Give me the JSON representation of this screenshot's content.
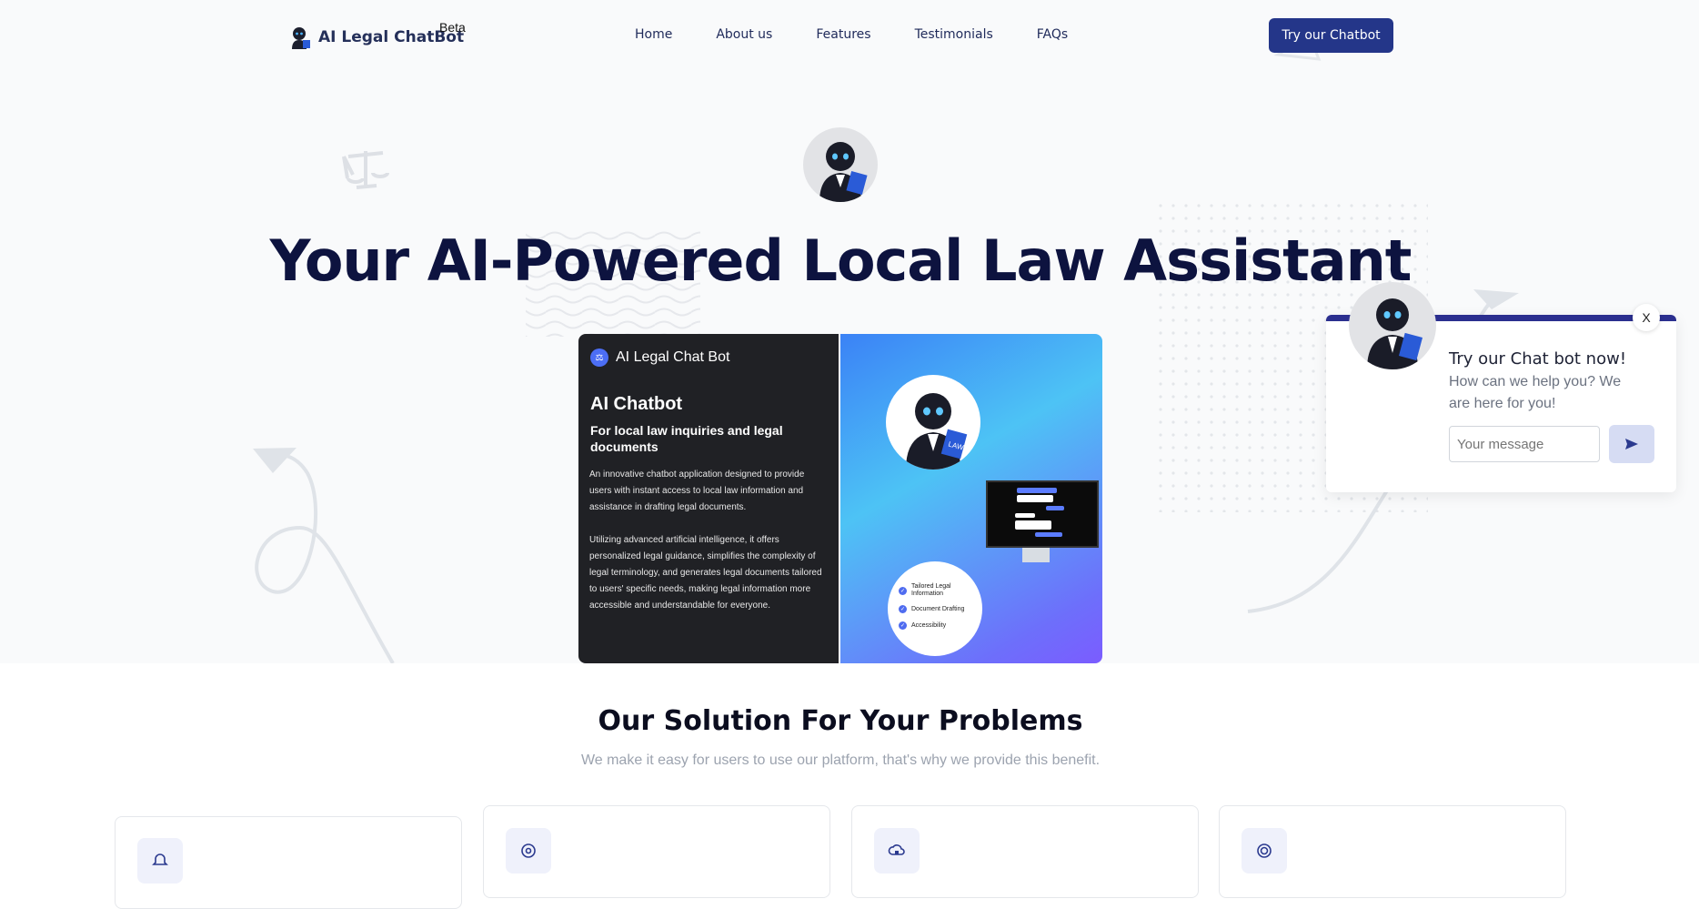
{
  "nav": {
    "logo_text": "AI Legal ChatBot",
    "beta": "Beta",
    "links": [
      "Home",
      "About us",
      "Features",
      "Testimonials",
      "FAQs"
    ],
    "cta": "Try our Chatbot"
  },
  "hero": {
    "headline": "Your AI-Powered Local Law Assistant"
  },
  "preview": {
    "app_title": "AI Legal Chat Bot",
    "heading": "AI Chatbot",
    "subheading": "For local law inquiries and legal documents",
    "para1": "An innovative chatbot application designed to provide users with instant access to local law information and assistance in drafting legal documents.",
    "para2": "Utilizing advanced artificial intelligence, it offers personalized legal guidance, simplifies the complexity of legal terminology, and generates legal documents tailored to users' specific needs, making legal information more accessible and understandable for everyone.",
    "book_label": "LAW",
    "features": [
      "Tailored Legal Information",
      "Document Drafting",
      "Accessibility"
    ]
  },
  "widget": {
    "close": "X",
    "title": "Try our Chat bot now!",
    "subtitle": "How can we help you? We are here for you!",
    "placeholder": "Your message"
  },
  "solution": {
    "title": "Our Solution For Your Problems",
    "subtitle": "We make it easy for users to use our platform, that's why we provide this benefit."
  },
  "colors": {
    "primary": "#243689",
    "headline": "#0d133f",
    "hero_bg": "#f9fafb",
    "widget_accent": "#2b2f8f"
  }
}
